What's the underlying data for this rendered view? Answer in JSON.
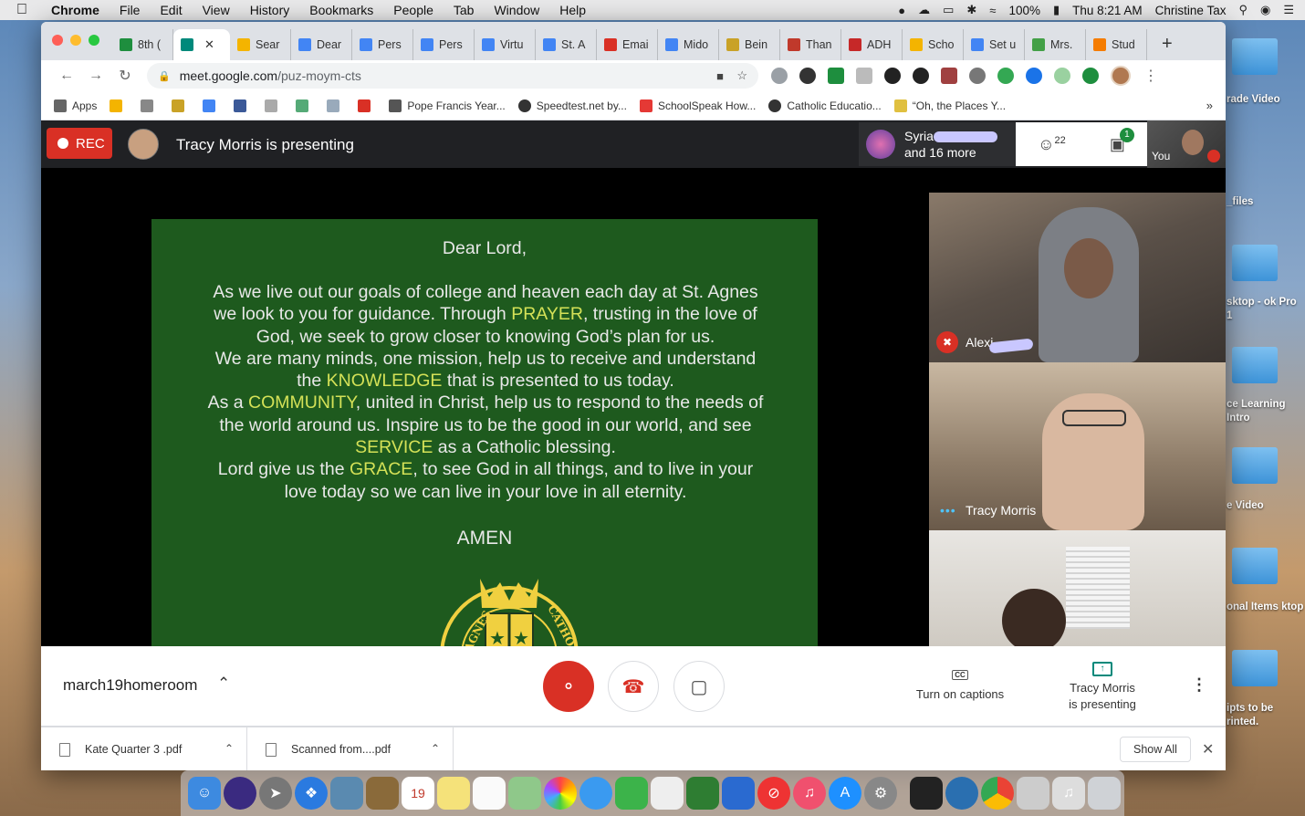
{
  "menubar": {
    "app": "Chrome",
    "items": [
      "File",
      "Edit",
      "View",
      "History",
      "Bookmarks",
      "People",
      "Tab",
      "Window",
      "Help"
    ],
    "battery": "100%",
    "clock": "Thu 8:21 AM",
    "user": "Christine Tax"
  },
  "desktop": {
    "labels": [
      "rade Video",
      "_files",
      "sktop - ok Pro 1",
      "ce Learning Intro",
      "e Video",
      "onal Items ktop",
      "ipts to be rinted."
    ]
  },
  "browser": {
    "tabs": [
      {
        "label": "8th (",
        "color": "#1e8e3e"
      },
      {
        "label": "",
        "color": "#00897b",
        "active": true
      },
      {
        "label": "Sear",
        "color": "#f4b400"
      },
      {
        "label": "Dear",
        "color": "#4285f4"
      },
      {
        "label": "Pers",
        "color": "#4285f4"
      },
      {
        "label": "Pers",
        "color": "#4285f4"
      },
      {
        "label": "Virtu",
        "color": "#4285f4"
      },
      {
        "label": "St. A",
        "color": "#4285f4"
      },
      {
        "label": "Emai",
        "color": "#d93025"
      },
      {
        "label": "Mido",
        "color": "#4285f4"
      },
      {
        "label": "Bein",
        "color": "#c9a227"
      },
      {
        "label": "Than",
        "color": "#c0392b"
      },
      {
        "label": "ADH",
        "color": "#c62828"
      },
      {
        "label": "Scho",
        "color": "#f4b400"
      },
      {
        "label": "Set u",
        "color": "#4285f4"
      },
      {
        "label": "Mrs.",
        "color": "#43a047"
      },
      {
        "label": "Stud",
        "color": "#f57c00"
      }
    ],
    "url_host": "meet.google.com",
    "url_path": "/puz-moym-cts",
    "bookmarks": [
      "Apps",
      "Pope Francis Year...",
      "Speedtest.net by...",
      "SchoolSpeak How...",
      "Catholic Educatio...",
      "“Oh, the Places Y..."
    ]
  },
  "meet": {
    "rec_label": "REC",
    "presenting": "Tracy Morris is presenting",
    "participants_name": "Syria",
    "participants_more": "and 16 more",
    "participant_count": "22",
    "chat_count": "1",
    "self_label": "You",
    "slide": {
      "greeting": "Dear Lord,",
      "lines": [
        [
          {
            "t": "As we live out our goals of college and heaven each day at St. Agnes"
          }
        ],
        [
          {
            "t": "we look to you for guidance.  Through "
          },
          {
            "t": "PRAYER",
            "hl": true
          },
          {
            "t": ", trusting in the love of"
          }
        ],
        [
          {
            "t": "God, we seek to grow closer to knowing God’s plan for us."
          }
        ],
        [
          {
            "t": "We are many minds, one mission, help us to receive and understand"
          }
        ],
        [
          {
            "t": "the "
          },
          {
            "t": "KNOWLEDGE",
            "hl": true
          },
          {
            "t": " that is presented to us today."
          }
        ],
        [
          {
            "t": "As a "
          },
          {
            "t": "COMMUNITY",
            "hl": true
          },
          {
            "t": ", united in Christ, help us to respond to the needs of"
          }
        ],
        [
          {
            "t": "the world around us.  Inspire us to be the good in our world,  and see"
          }
        ],
        [
          {
            "t": "SERVICE",
            "hl": true
          },
          {
            "t": " as a Catholic blessing."
          }
        ],
        [
          {
            "t": "Lord give us the "
          },
          {
            "t": "GRACE",
            "hl": true
          },
          {
            "t": ", to see God in all things, and to live in your"
          }
        ],
        [
          {
            "t": "love today so we can live in your love in all eternity."
          }
        ]
      ],
      "amen": "AMEN",
      "seal_left": "ST. AGNES",
      "seal_right": "CATHOLIC"
    },
    "tiles": [
      {
        "name": "Alexi",
        "muted": true
      },
      {
        "name": "Tracy Morris",
        "speaking": true
      },
      {
        "name": ""
      }
    ],
    "meeting_code": "march19homeroom",
    "captions_label": "Turn on captions",
    "present_label_1": "Tracy Morris",
    "present_label_2": "is presenting"
  },
  "downloads": {
    "items": [
      "Kate Quarter 3 .pdf",
      "Scanned from....pdf"
    ],
    "show_all": "Show All"
  },
  "dock": {
    "calendar_day": "19"
  }
}
